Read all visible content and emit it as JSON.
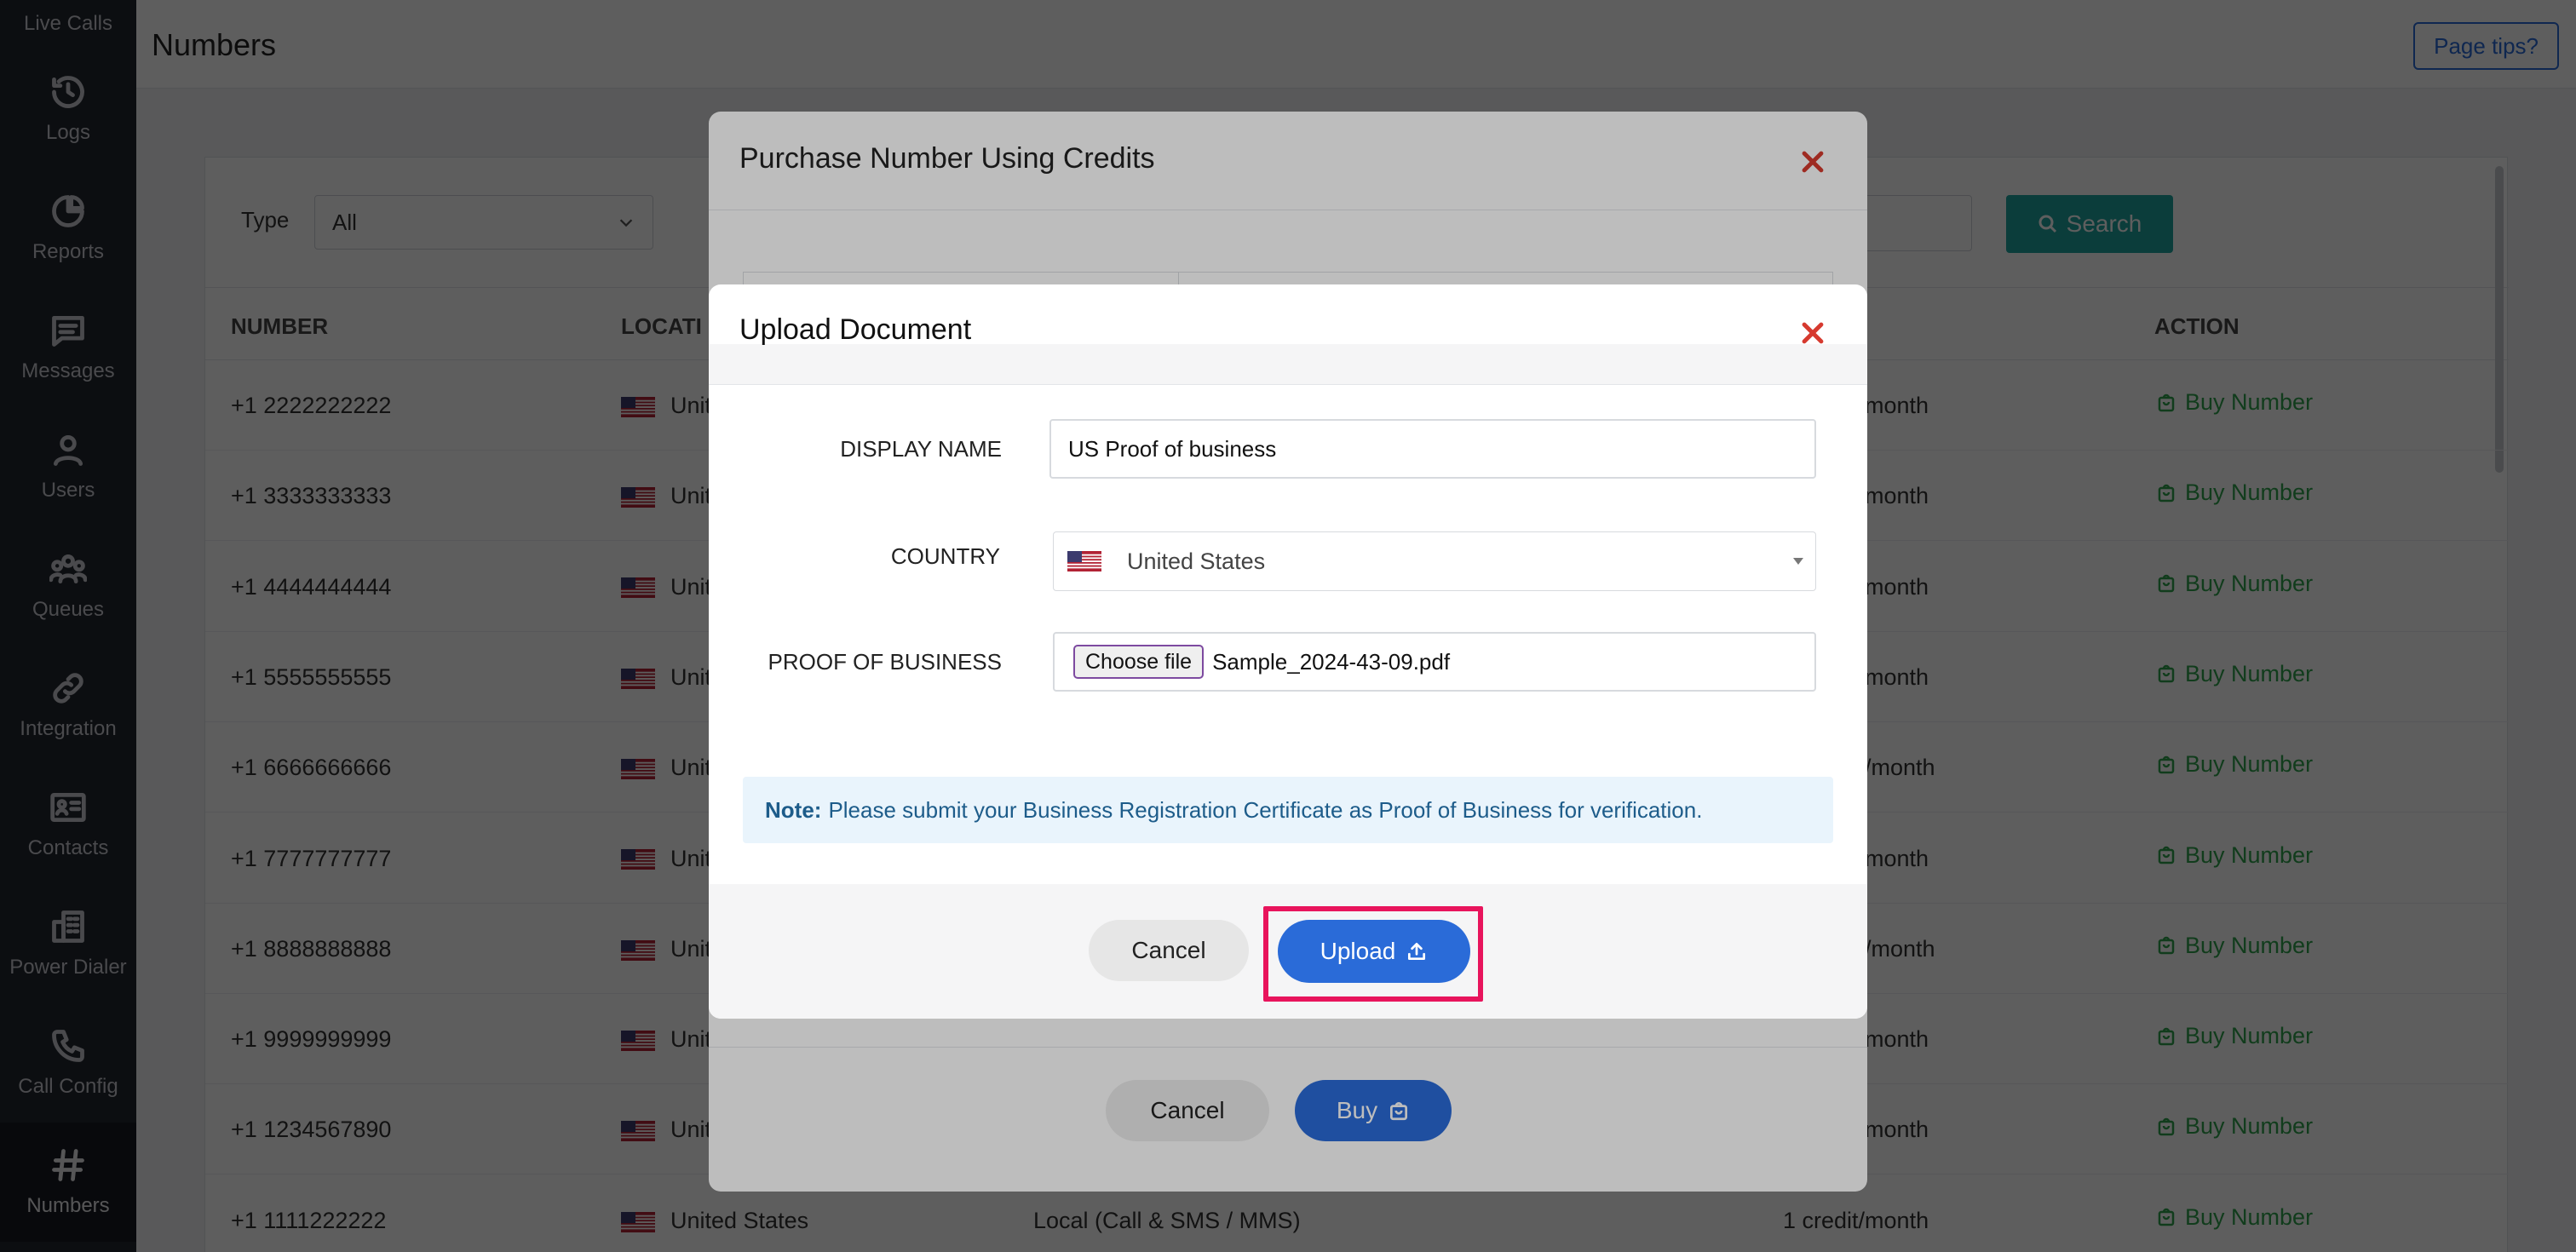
{
  "sidebar": {
    "top_label": "Live Calls",
    "items": [
      {
        "label": "Logs",
        "icon": "history-icon"
      },
      {
        "label": "Reports",
        "icon": "pie-chart-icon"
      },
      {
        "label": "Messages",
        "icon": "message-icon"
      },
      {
        "label": "Users",
        "icon": "user-icon"
      },
      {
        "label": "Queues",
        "icon": "group-icon"
      },
      {
        "label": "Integration",
        "icon": "link-icon"
      },
      {
        "label": "Contacts",
        "icon": "contact-card-icon"
      },
      {
        "label": "Power Dialer",
        "icon": "building-icon"
      },
      {
        "label": "Call Config",
        "icon": "phone-icon"
      },
      {
        "label": "Numbers",
        "icon": "hash-icon"
      }
    ]
  },
  "header": {
    "title": "Numbers",
    "tips_label": "Page tips?"
  },
  "filters": {
    "type_label": "Type",
    "type_value": "All",
    "search_label": "Search"
  },
  "table": {
    "columns": {
      "number": "NUMBER",
      "location": "LOCATI",
      "action": "ACTION"
    },
    "rows": [
      {
        "number": "+1 2222222222",
        "location": "Unit",
        "price": "month",
        "action": "Buy Number"
      },
      {
        "number": "+1 3333333333",
        "location": "Unit",
        "price": "month",
        "action": "Buy Number"
      },
      {
        "number": "+1 4444444444",
        "location": "Unit",
        "price": "month",
        "action": "Buy Number"
      },
      {
        "number": "+1 5555555555",
        "location": "Unit",
        "price": "month",
        "action": "Buy Number"
      },
      {
        "number": "+1 6666666666",
        "location": "Unit",
        "price": "/month",
        "action": "Buy Number"
      },
      {
        "number": "+1 7777777777",
        "location": "Unit",
        "price": "month",
        "action": "Buy Number"
      },
      {
        "number": "+1 8888888888",
        "location": "Unit",
        "price": "/month",
        "action": "Buy Number"
      },
      {
        "number": "+1 9999999999",
        "location": "Unit",
        "price": "month",
        "action": "Buy Number"
      },
      {
        "number": "+1 1234567890",
        "location": "Unit",
        "price": "month",
        "action": "Buy Number"
      }
    ],
    "last_row": {
      "number": "+1 1111222222",
      "location": "United States",
      "type": "Local (Call & SMS / MMS)",
      "price": "1 credit/month",
      "action": "Buy Number"
    }
  },
  "purchase_modal": {
    "title": "Purchase Number Using Credits",
    "cancel_label": "Cancel",
    "buy_label": "Buy"
  },
  "upload_modal": {
    "title": "Upload Document",
    "display_name_label": "DISPLAY NAME",
    "display_name_value": "US Proof of business",
    "country_label": "COUNTRY",
    "country_value": "United States",
    "proof_label": "PROOF OF BUSINESS",
    "choose_file_label": "Choose file",
    "file_name": "Sample_2024-43-09.pdf",
    "note_bold": "Note:",
    "note_text": "Please submit your Business Registration Certificate as Proof of Business for verification.",
    "cancel_label": "Cancel",
    "upload_label": "Upload"
  },
  "colors": {
    "primary": "#2a6bd8",
    "success": "#2ea44f",
    "teal": "#1fa7a0",
    "danger": "#d63a2f",
    "highlight": "#e8145c",
    "sidebar": "#23262f"
  }
}
